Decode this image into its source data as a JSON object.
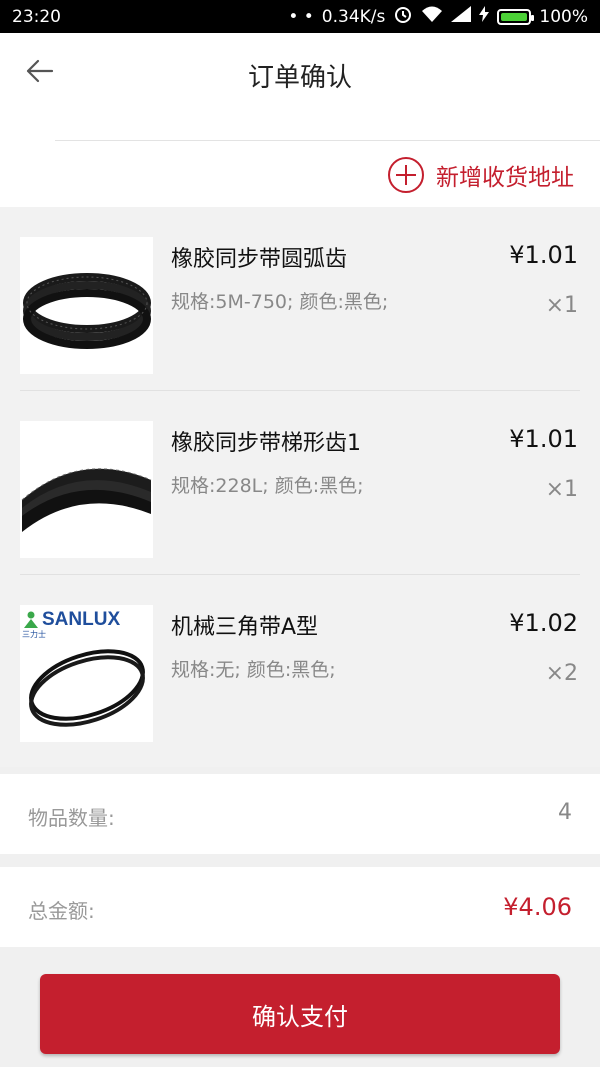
{
  "status_bar": {
    "time": "23:20",
    "dots": "• •",
    "speed": "0.34K/s",
    "battery": "100%"
  },
  "header": {
    "title": "订单确认"
  },
  "address": {
    "add_label": "新增收货地址"
  },
  "items": [
    {
      "name": "橡胶同步带圆弧齿",
      "spec": "规格:5M-750; 颜色:黑色;",
      "price": "¥1.01",
      "qty": "×1",
      "image_icon": "timing-belt-round-tooth-image"
    },
    {
      "name": "橡胶同步带梯形齿1",
      "spec": "规格:228L; 颜色:黑色;",
      "price": "¥1.01",
      "qty": "×1",
      "image_icon": "timing-belt-trapezoid-tooth-image"
    },
    {
      "name": "机械三角带A型",
      "spec": "规格:无; 颜色:黑色;",
      "price": "¥1.02",
      "qty": "×2",
      "image_icon": "v-belt-image",
      "brand_text": "SANLUX",
      "brand_sub": "三力士"
    }
  ],
  "summary": {
    "count_label": "物品数量:",
    "count_value": "4",
    "total_label": "总金额:",
    "total_value": "¥4.06"
  },
  "actions": {
    "pay_label": "确认支付"
  },
  "colors": {
    "accent": "#c41f2e",
    "background": "#f0f0f0"
  }
}
